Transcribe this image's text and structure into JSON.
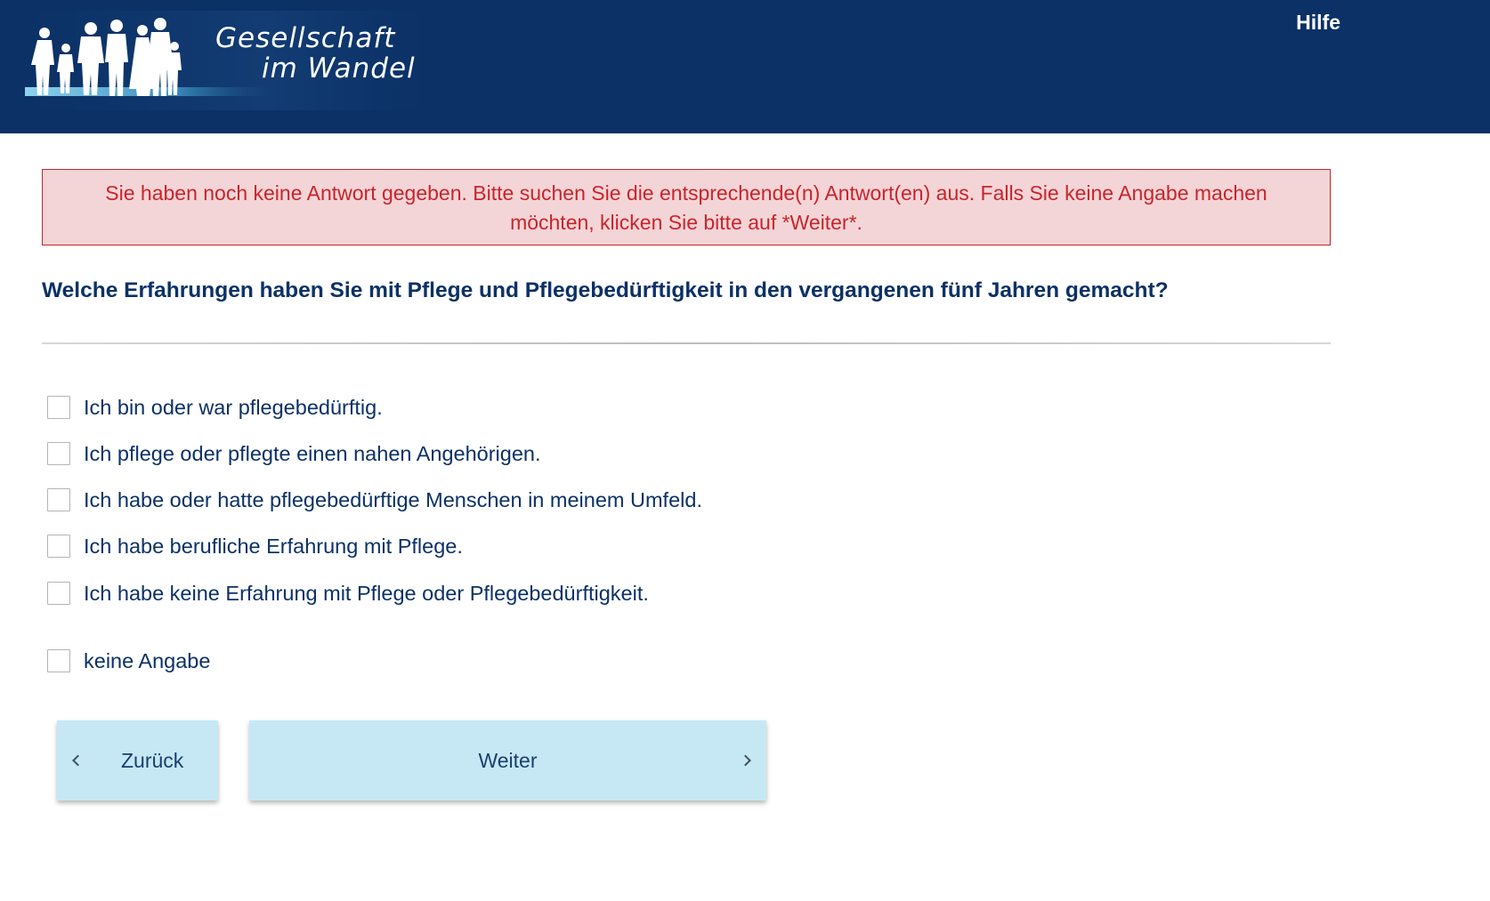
{
  "header": {
    "logo": {
      "line1": "Gesellschaft",
      "line2": "im Wandel"
    },
    "help_label": "Hilfe"
  },
  "error": {
    "message": "Sie haben noch keine Antwort gegeben. Bitte suchen Sie die entsprechende(n) Antwort(en) aus. Falls Sie keine Angabe machen möchten, klicken Sie bitte auf *Weiter*."
  },
  "question": {
    "text": "Welche Erfahrungen haben Sie mit Pflege und Pflegebedürftigkeit in den vergangenen fünf Jahren gemacht?"
  },
  "options": [
    {
      "label": "Ich bin oder war pflegebedürftig.",
      "checked": false
    },
    {
      "label": "Ich pflege oder pflegte einen nahen Angehörigen.",
      "checked": false
    },
    {
      "label": "Ich habe oder hatte pflegebedürftige Menschen in meinem Umfeld.",
      "checked": false
    },
    {
      "label": "Ich habe berufliche Erfahrung mit Pflege.",
      "checked": false
    },
    {
      "label": "Ich habe keine Erfahrung mit Pflege oder Pflegebedürftigkeit.",
      "checked": false
    },
    {
      "label": "keine Angabe",
      "checked": false
    }
  ],
  "navigation": {
    "back_label": "Zurück",
    "next_label": "Weiter"
  },
  "colors": {
    "header_bg": "#0b3166",
    "error_text": "#c9242b",
    "error_bg": "#f4d5d7",
    "button_bg": "#c6e8f5",
    "text_primary": "#0b3166"
  },
  "icons": {
    "logo": "people-silhouettes-icon",
    "back": "chevron-left-icon",
    "next": "chevron-right-icon"
  }
}
